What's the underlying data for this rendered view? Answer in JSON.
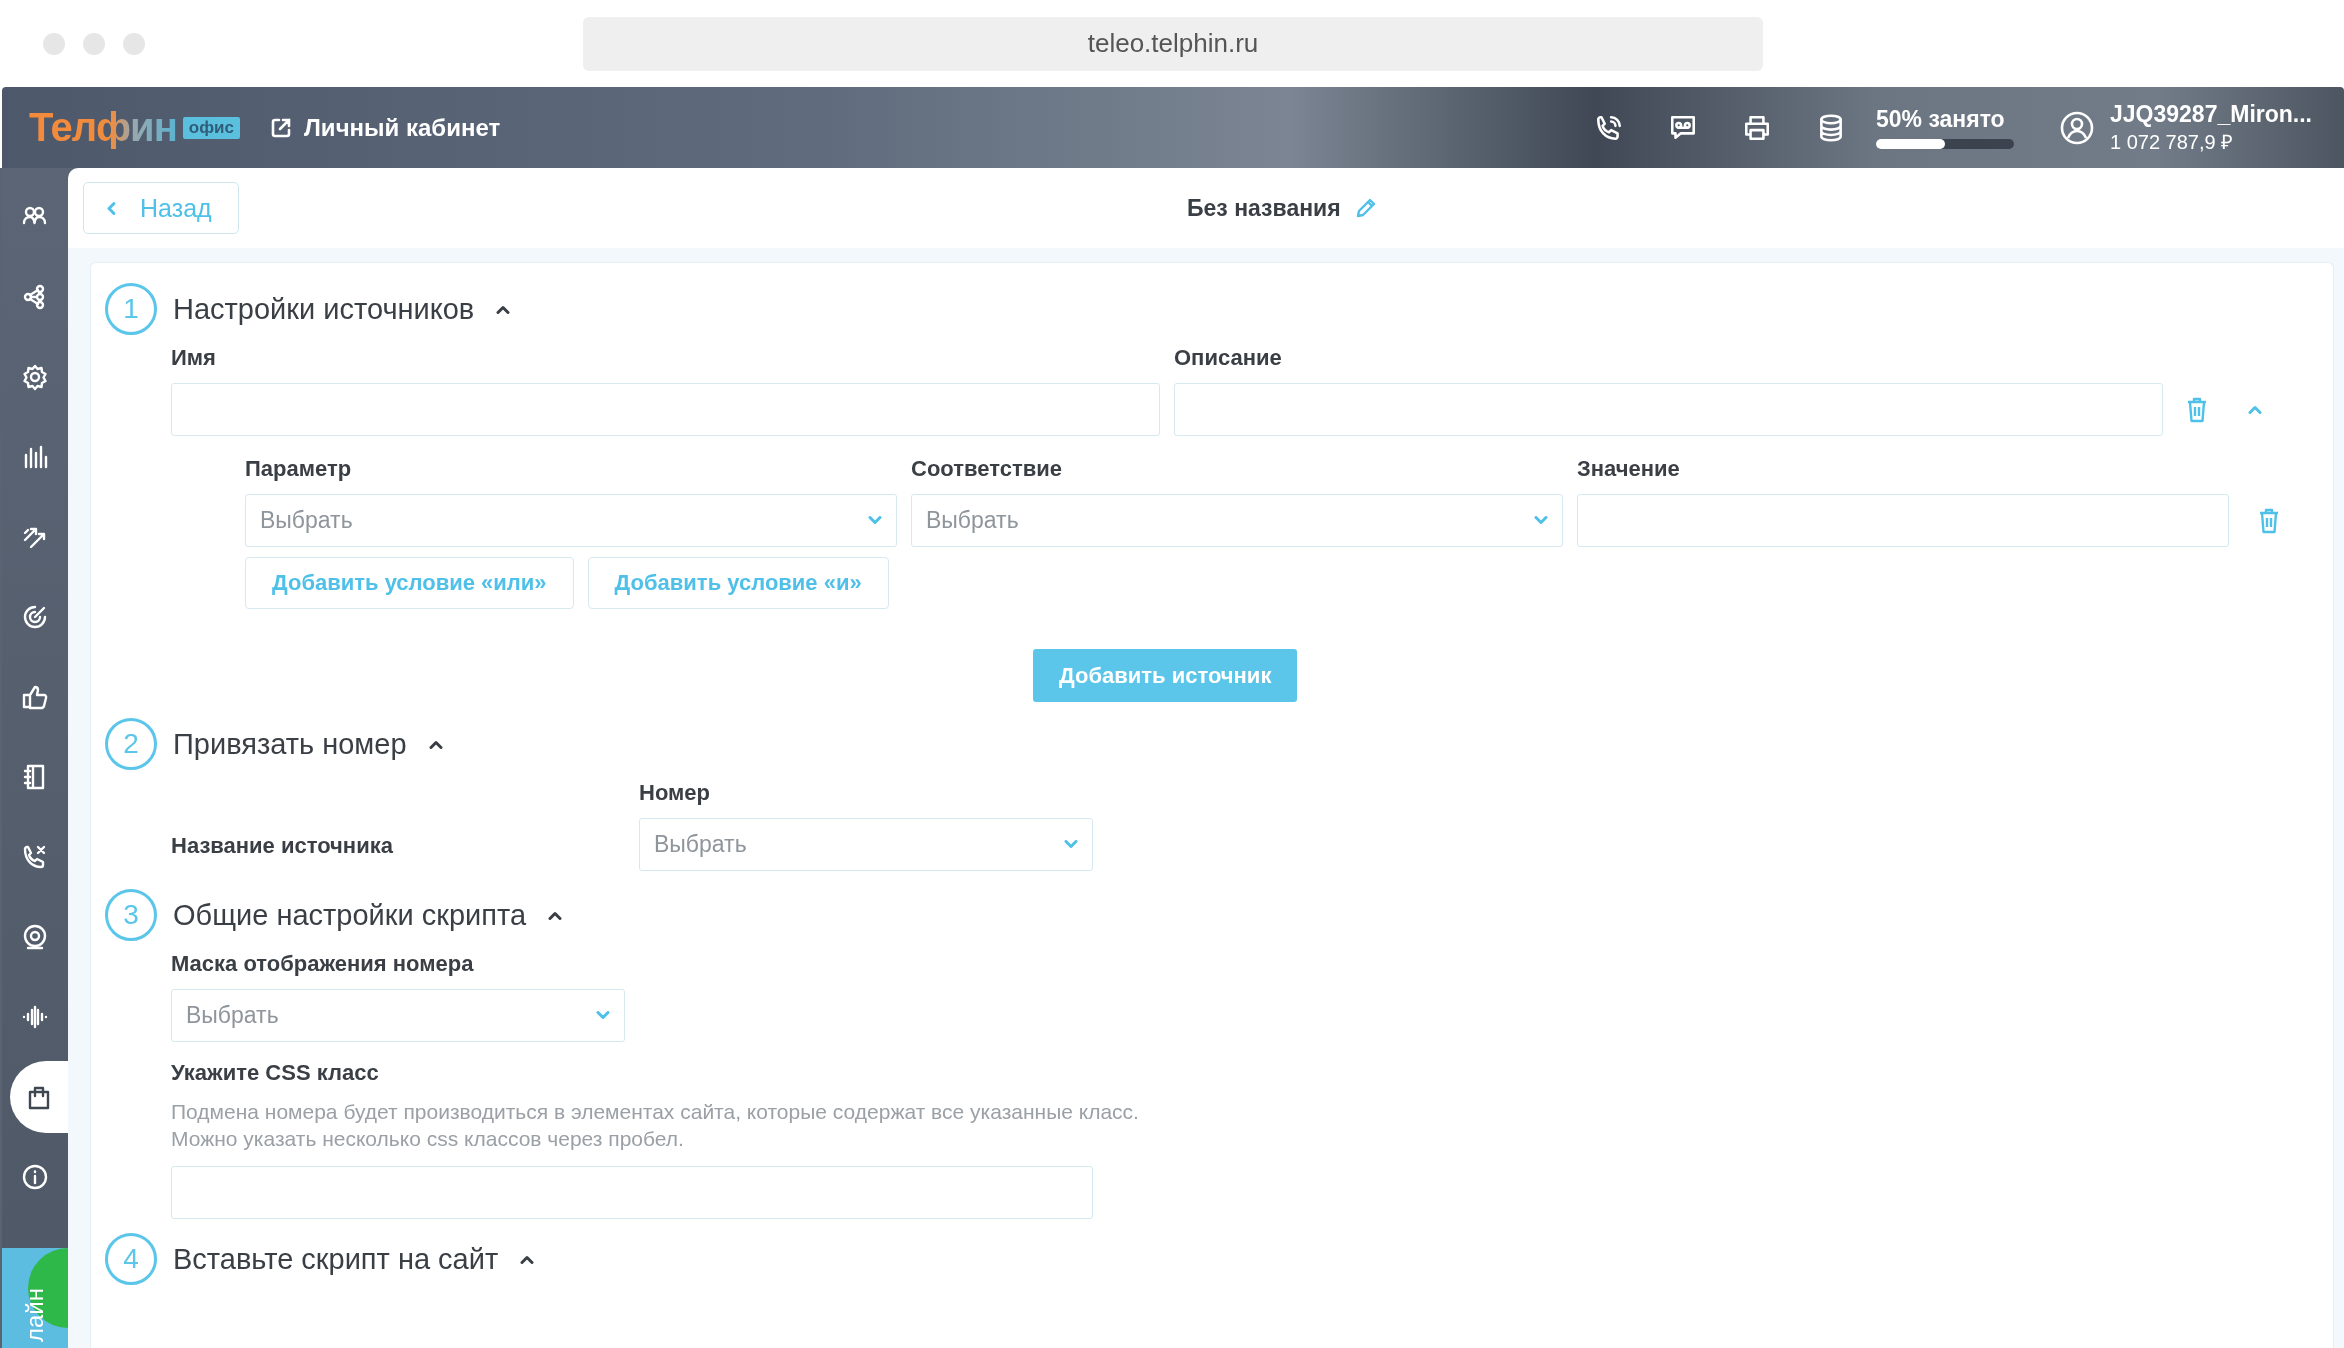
{
  "browser": {
    "url": "teleo.telphin.ru"
  },
  "header": {
    "logo": "Телфин",
    "logo_badge": "офис",
    "cabinet_link": "Личный кабинет",
    "storage": {
      "label": "50% занято",
      "level": 0.5
    },
    "account": {
      "name": "JJQ39287_Miron...",
      "balance": "1 072 787,9 ₽"
    }
  },
  "sidebar": {
    "items": [
      {
        "kind": "people",
        "selected": false
      },
      {
        "kind": "nodes",
        "selected": false
      },
      {
        "kind": "gear",
        "selected": false
      },
      {
        "kind": "bars",
        "selected": false
      },
      {
        "kind": "arrows",
        "selected": false
      },
      {
        "kind": "gauge",
        "selected": false
      },
      {
        "kind": "like",
        "selected": false
      },
      {
        "kind": "notebook",
        "selected": false
      },
      {
        "kind": "phone-x",
        "selected": false
      },
      {
        "kind": "webcam",
        "selected": false
      },
      {
        "kind": "wave",
        "selected": false
      },
      {
        "kind": "bag",
        "selected": true
      },
      {
        "kind": "info",
        "selected": false
      }
    ],
    "status": "лайн"
  },
  "page": {
    "back": "Назад",
    "title": "Без названия"
  },
  "sections": [
    {
      "kind": "sources",
      "number": "1",
      "title": "Настройки источников",
      "expanded": true,
      "name_label": "Имя",
      "description_label": "Описание",
      "columns": [
        "Параметр",
        "Соответствие",
        "Значение"
      ],
      "placeholders": [
        "Выбрать",
        "Выбрать"
      ],
      "buttons": [
        "Добавить условие «или»",
        "Добавить условие «и»"
      ],
      "add_button": "Добавить источник"
    },
    {
      "kind": "bind",
      "number": "2",
      "title": "Привязать номер",
      "expanded": true,
      "source_label": "Название источника",
      "number_label": "Номер",
      "number_placeholder": "Выбрать"
    },
    {
      "kind": "general",
      "number": "3",
      "title": "Общие настройки скрипта",
      "expanded": true,
      "mask_label": "Маска отображения номера",
      "mask_placeholder": "Выбрать",
      "css_label": "Укажите CSS класс",
      "css_help": [
        "Подмена номера будет производиться в элементах сайта, которые содержат все указанные класс.",
        "Можно указать несколько css классов через пробел."
      ]
    },
    {
      "kind": "insert",
      "number": "4",
      "title": "Вставьте скрипт на сайт",
      "expanded": true
    }
  ]
}
